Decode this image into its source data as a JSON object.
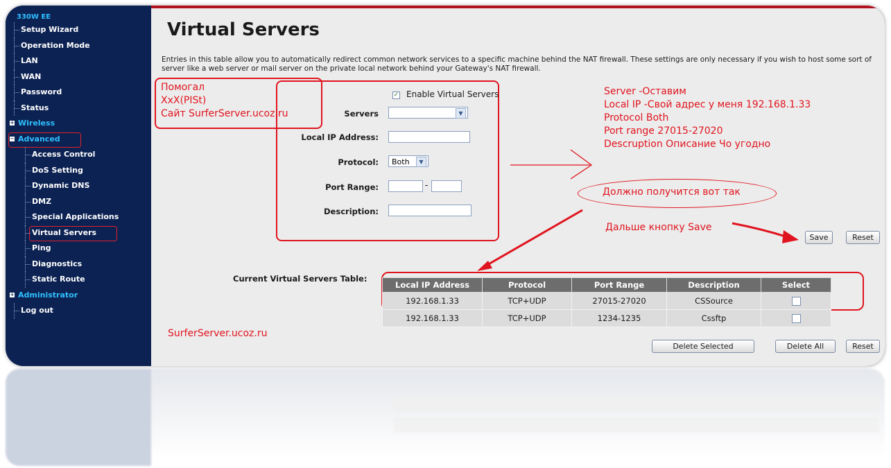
{
  "sidebar": {
    "brand": "330W EE",
    "items": [
      {
        "label": "Setup Wizard"
      },
      {
        "label": "Operation Mode"
      },
      {
        "label": "LAN"
      },
      {
        "label": "WAN"
      },
      {
        "label": "Password"
      },
      {
        "label": "Status"
      },
      {
        "label": "Wireless"
      },
      {
        "label": "Advanced"
      },
      {
        "label": "Access Control"
      },
      {
        "label": "DoS Setting"
      },
      {
        "label": "Dynamic DNS"
      },
      {
        "label": "DMZ"
      },
      {
        "label": "Special Applications"
      },
      {
        "label": "Virtual Servers"
      },
      {
        "label": "Ping"
      },
      {
        "label": "Diagnostics"
      },
      {
        "label": "Static Route"
      },
      {
        "label": "Administrator"
      },
      {
        "label": "Log out"
      }
    ]
  },
  "page": {
    "title": "Virtual Servers",
    "intro": "Entries in this table allow you to automatically redirect common network services to a specific machine behind the NAT firewall. These settings are only necessary if you wish to host some sort of server like a web server or mail server on the private local network behind your Gateway's NAT firewall."
  },
  "form": {
    "enable_label": "Enable Virtual Servers",
    "enable_checked": true,
    "servers_label": "Servers",
    "local_ip_label": "Local IP Address:",
    "protocol_label": "Protocol:",
    "protocol_value": "Both",
    "port_range_label": "Port Range:",
    "port_dash": "-",
    "description_label": "Description:",
    "save_label": "Save",
    "reset_label": "Reset"
  },
  "table": {
    "caption": "Current Virtual Servers Table:",
    "headers": [
      "Local IP Address",
      "Protocol",
      "Port Range",
      "Description",
      "Select"
    ],
    "rows": [
      {
        "ip": "192.168.1.33",
        "protocol": "TCP+UDP",
        "ports": "27015-27020",
        "description": "CSSource"
      },
      {
        "ip": "192.168.1.33",
        "protocol": "TCP+UDP",
        "ports": "1234-1235",
        "description": "Cssftp"
      }
    ],
    "delete_selected_label": "Delete Selected",
    "delete_all_label": "Delete All",
    "reset_label": "Reset"
  },
  "annotations": {
    "credits": [
      "Помогал",
      "XxX(PISt)",
      "Сайт SurferServer.ucoz.ru"
    ],
    "instructions": [
      "Server -Оставим",
      "Local IP -Свой адрес у меня 192.168.1.33",
      "Protocol Both",
      "Port range 27015-27020",
      "Descruption Описание Чо угодно"
    ],
    "result_note": "Должно получится вот так",
    "save_note": "Дальше кнопку Save",
    "site": "SurferServer.ucoz.ru"
  },
  "colors": {
    "sidebar_bg": "#0c2253",
    "accent_blue": "#2fc0ff",
    "annotation_red": "#e0141e",
    "table_header": "#6d6d6d",
    "content_bg": "#ececec"
  }
}
